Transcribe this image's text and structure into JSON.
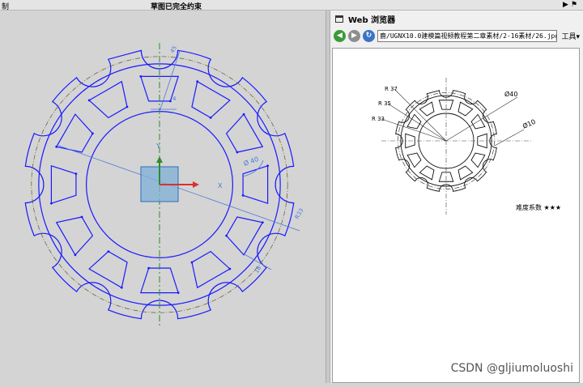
{
  "topbar": {
    "left_label": "制",
    "status": "草图已完全约束",
    "icons": [
      "pin-icon",
      "flag-icon"
    ]
  },
  "sketch": {
    "dims": {
      "d_rt": "45",
      "d_w": "4",
      "d_dia": "Ø 40",
      "d_r": "R33",
      "d_b": "18"
    },
    "axis_x": "X",
    "axis_y": "Y",
    "colors": {
      "outline": "#1a1aff",
      "dim": "#4a7ad8",
      "center": "#2d8c2d"
    }
  },
  "browser": {
    "title": "Web 浏览器",
    "url": "鹿/UGNX10.0建模篇视频教程第二章素材/2-16素材/26.jpg",
    "tools": "工具▾"
  },
  "drawing": {
    "r37": "R 37",
    "r35": "R 35",
    "r33": "R 33",
    "dia40": "Ø40",
    "dia10": "Ø10",
    "difficulty": "难度系数 ★★★"
  },
  "watermark": "CSDN @gljiumoluoshi"
}
